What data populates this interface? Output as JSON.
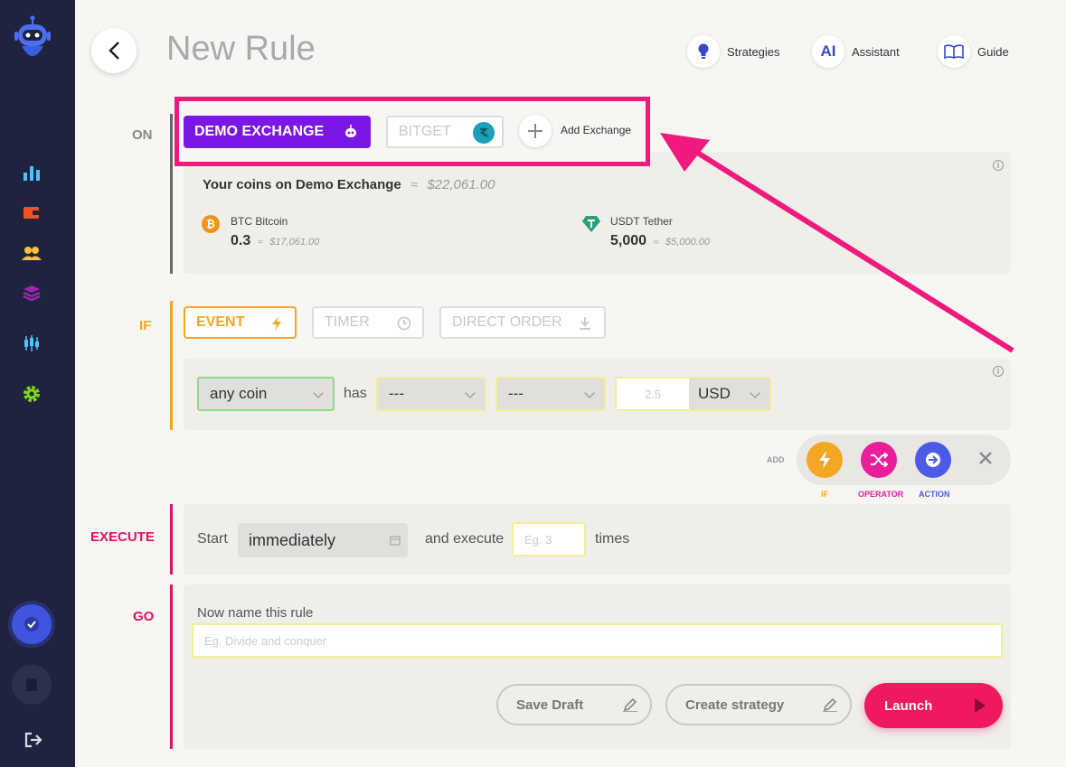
{
  "header": {
    "title": "New Rule",
    "links": [
      {
        "label": "Strategies",
        "icon": "lightbulb-icon"
      },
      {
        "label": "Assistant",
        "icon": "ai-icon",
        "icon_text": "AI"
      },
      {
        "label": "Guide",
        "icon": "book-icon"
      }
    ]
  },
  "sections": {
    "on": "ON",
    "if": "IF",
    "execute": "EXECUTE",
    "go": "GO"
  },
  "exchanges": {
    "active": "DEMO EXCHANGE",
    "inactive": "BITGET",
    "add_label": "Add Exchange"
  },
  "coins": {
    "heading": "Your coins on Demo Exchange",
    "approx": "≈",
    "total": "$22,061.00",
    "items": [
      {
        "name": "BTC Bitcoin",
        "amount": "0.3",
        "approx": "≈",
        "value": "$17,061.00",
        "color": "#f7931a"
      },
      {
        "name": "USDT Tether",
        "amount": "5,000",
        "approx": "≈",
        "value": "$5,000.00",
        "color": "#26a17b"
      }
    ]
  },
  "trigger_tabs": {
    "event": "EVENT",
    "timer": "TIMER",
    "direct_order": "DIRECT ORDER"
  },
  "condition": {
    "coin": "any coin",
    "has": "has",
    "field1": "---",
    "field2": "---",
    "amount_placeholder": "2.5",
    "currency": "USD"
  },
  "add_bar": {
    "label": "ADD",
    "if": "IF",
    "operator": "OPERATOR",
    "action": "ACTION"
  },
  "execute": {
    "start": "Start",
    "when": "immediately",
    "and_execute": "and execute",
    "times_placeholder": "Eg. 3",
    "times": "times"
  },
  "go": {
    "name_label": "Now name this rule",
    "name_placeholder": "Eg. Divide and conquer",
    "save_draft": "Save Draft",
    "create_strategy": "Create strategy",
    "launch": "Launch"
  },
  "colors": {
    "sidebar": "#1f2340",
    "purple": "#7b17e6",
    "orange": "#f5a623",
    "pink": "#e8115f",
    "highlight": "#f0197d",
    "operator": "#e91e9b",
    "action": "#4b5be8"
  }
}
